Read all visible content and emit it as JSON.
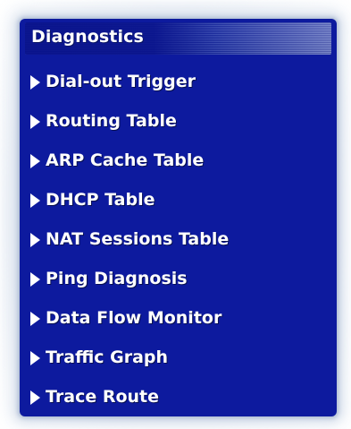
{
  "section": {
    "title": "Diagnostics"
  },
  "menu": {
    "items": [
      {
        "label": "Dial-out Trigger",
        "icon": "triangle-right-icon"
      },
      {
        "label": "Routing Table",
        "icon": "triangle-right-icon"
      },
      {
        "label": "ARP Cache Table",
        "icon": "triangle-right-icon"
      },
      {
        "label": "DHCP Table",
        "icon": "triangle-right-icon"
      },
      {
        "label": "NAT Sessions Table",
        "icon": "triangle-right-icon"
      },
      {
        "label": "Ping Diagnosis",
        "icon": "triangle-right-icon"
      },
      {
        "label": "Data Flow Monitor",
        "icon": "triangle-right-icon"
      },
      {
        "label": "Traffic Graph",
        "icon": "triangle-right-icon"
      },
      {
        "label": "Trace Route",
        "icon": "triangle-right-icon"
      }
    ]
  },
  "colors": {
    "panel_background": "#0d1a9e",
    "text": "#ffffff"
  }
}
